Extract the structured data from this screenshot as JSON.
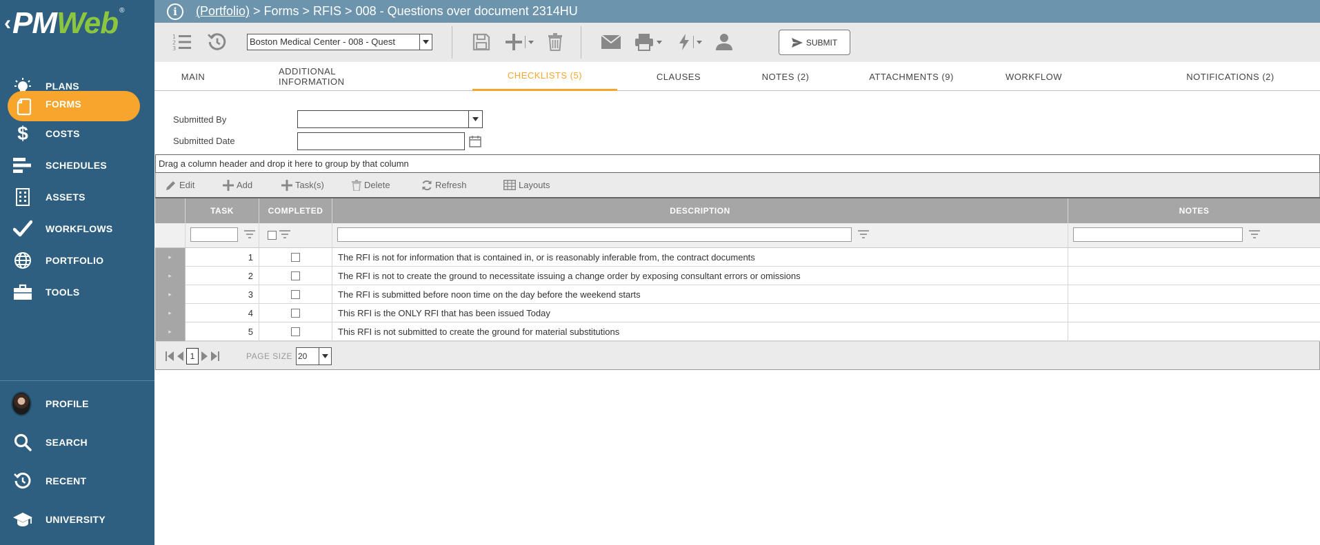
{
  "brand": {
    "prefix": "‹",
    "name_a": "PM",
    "name_b": "Web",
    "reg": "®"
  },
  "sidebar": {
    "items": [
      {
        "id": "plans",
        "label": "PLANS",
        "icon": "lightbulb-icon"
      },
      {
        "id": "forms",
        "label": "FORMS",
        "icon": "document-icon",
        "active": true
      },
      {
        "id": "costs",
        "label": "COSTS",
        "icon": "dollar-icon"
      },
      {
        "id": "schedules",
        "label": "SCHEDULES",
        "icon": "gantt-icon"
      },
      {
        "id": "assets",
        "label": "ASSETS",
        "icon": "building-icon"
      },
      {
        "id": "workflows",
        "label": "WORKFLOWS",
        "icon": "checkmark-icon"
      },
      {
        "id": "portfolio",
        "label": "PORTFOLIO",
        "icon": "globe-icon"
      },
      {
        "id": "tools",
        "label": "TOOLS",
        "icon": "briefcase-icon"
      }
    ],
    "bottom": [
      {
        "id": "profile",
        "label": "PROFILE",
        "icon": "avatar"
      },
      {
        "id": "search",
        "label": "SEARCH",
        "icon": "search-icon"
      },
      {
        "id": "recent",
        "label": "RECENT",
        "icon": "history-icon"
      },
      {
        "id": "university",
        "label": "UNIVERSITY",
        "icon": "graduation-cap-icon"
      }
    ],
    "accent": "#f8a52d",
    "background": "#2e5f80"
  },
  "breadcrumb": {
    "link": "(Portfolio)",
    "rest": " > Forms > RFIS > 008 - Questions over document 2314HU"
  },
  "toolbar": {
    "record_select_value": "Boston Medical Center - 008 - Quest",
    "submit_label": "SUBMIT"
  },
  "tabs": [
    {
      "label": "MAIN"
    },
    {
      "label": "ADDITIONAL INFORMATION"
    },
    {
      "label": "CHECKLISTS (5)",
      "active": true
    },
    {
      "label": "CLAUSES"
    },
    {
      "label": "NOTES (2)"
    },
    {
      "label": "ATTACHMENTS (9)"
    },
    {
      "label": "WORKFLOW"
    },
    {
      "label": "NOTIFICATIONS (2)"
    }
  ],
  "form": {
    "submitted_by_label": "Submitted By",
    "submitted_by_value": "",
    "submitted_date_label": "Submitted Date",
    "submitted_date_value": ""
  },
  "grid": {
    "group_hint": "Drag a column header and drop it here to group by that column",
    "toolbar": {
      "edit": "Edit",
      "add": "Add",
      "tasks": "Task(s)",
      "delete": "Delete",
      "refresh": "Refresh",
      "layouts": "Layouts"
    },
    "columns": {
      "task": "TASK",
      "completed": "COMPLETED",
      "description": "DESCRIPTION",
      "notes": "NOTES"
    },
    "rows": [
      {
        "task": "1",
        "completed": false,
        "description": "The RFI is not for information that is contained in, or is reasonably inferable from, the contract documents",
        "notes": ""
      },
      {
        "task": "2",
        "completed": false,
        "description": "The RFI is not to create the ground to necessitate issuing a change order by exposing consultant errors or omissions",
        "notes": ""
      },
      {
        "task": "3",
        "completed": false,
        "description": "The RFI is submitted before noon time on the day before the weekend starts",
        "notes": ""
      },
      {
        "task": "4",
        "completed": false,
        "description": "This RFI is the ONLY RFI that has been issued Today",
        "notes": ""
      },
      {
        "task": "5",
        "completed": false,
        "description": "This RFI is not submitted to create the ground for material substitutions",
        "notes": ""
      }
    ],
    "pager": {
      "current_page": "1",
      "page_size_label": "PAGE SIZE",
      "page_size": "20"
    }
  }
}
